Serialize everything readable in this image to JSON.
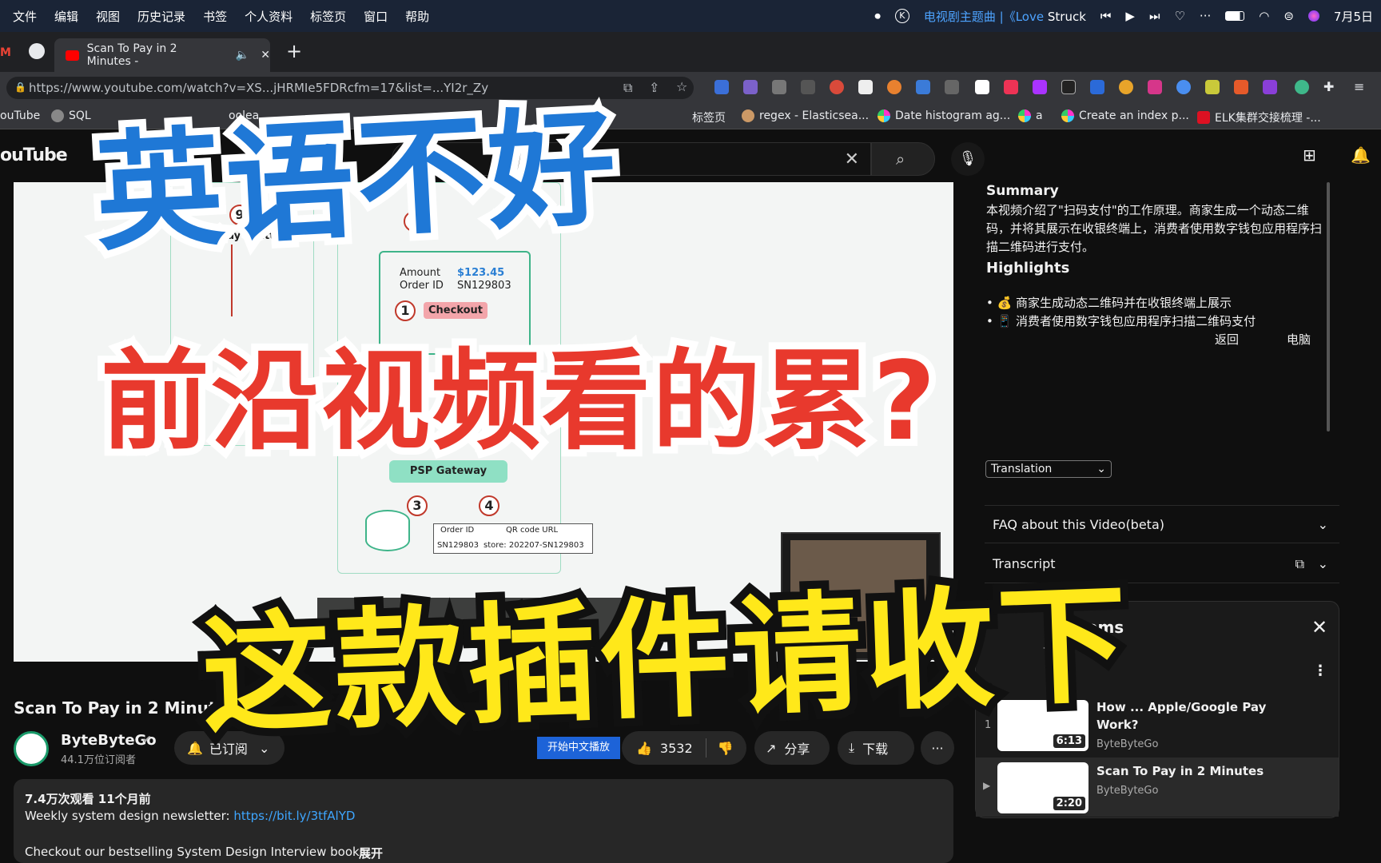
{
  "menubar": {
    "items": [
      "文件",
      "编辑",
      "视图",
      "历史记录",
      "书签",
      "个人资料",
      "标签页",
      "窗口",
      "帮助"
    ],
    "now_playing": "电视剧主题曲 |《Love",
    "now_playing_artist": "Struck",
    "date": "7月5日"
  },
  "tabs": {
    "active_title": "Scan To Pay in 2 Minutes -",
    "new_tab": "+"
  },
  "address": {
    "url": "https://www.youtube.com/watch?v=XS...jHRMIe5FDRcfm=17&list=...YI2r_Zy"
  },
  "bookmarks": [
    "ouTube",
    "SQL",
    "oolea",
    "标签页",
    "regex - Elasticsea...",
    "Date histogram ag...",
    "a",
    "Create an index p...",
    "ELK集群交接梳理 -..."
  ],
  "youtube": {
    "logo": "ouTube"
  },
  "video": {
    "amount_label": "Amount",
    "amount_value": "$123.45",
    "order_label": "Order ID",
    "order_value": "SN129803",
    "checkout": "Checkout",
    "click_pay": "Click \"Pay\" button",
    "gateway": "PSP Gateway",
    "tbl_order_id": "Order ID",
    "tbl_qr_url": "QR code URL",
    "tbl_order_val": "SN129803",
    "tbl_qr_val": "store: 202207-SN129803",
    "n1": "1",
    "n3": "3",
    "n4": "4",
    "n6": "6",
    "n9": "9"
  },
  "side": {
    "summary_heading": "Summary",
    "summary_text": "本视频介绍了\"扫码支付\"的工作原理。商家生成一个动态二维码，并将其展示在收银终端上，消费者使用数字钱包应用程序扫描二维码进行支付。",
    "highlights_heading": "Highlights",
    "h1": "• 💰 商家生成动态二维码并在收银终端上展示",
    "h2": "• 📱 消费者使用数字钱包应用程序扫描二维码支付",
    "h3": "返回",
    "h4": "电脑",
    "translation": "Translation",
    "faq": "FAQ about this Video(beta)",
    "transcript": "Transcript"
  },
  "playlist": {
    "title": "Systems",
    "count": "- 2 / 2",
    "items": [
      {
        "index": "1",
        "title": "How ... Apple/Google Pay Work?",
        "channel": "ByteByteGo",
        "duration": "6:13"
      },
      {
        "index": "▶",
        "title": "Scan To Pay in 2 Minutes",
        "channel": "ByteByteGo",
        "duration": "2:20"
      }
    ]
  },
  "meta": {
    "title": "Scan To Pay in 2 Minutes",
    "channel": "ByteByteGo",
    "subs": "44.1万位订阅者",
    "subscribed": "已订阅",
    "cn_play": "开始中文播放",
    "likes": "3532",
    "share": "分享",
    "download": "下载",
    "more": "···"
  },
  "description": {
    "stats": "7.4万次观看  11个月前",
    "line1": "Weekly system design newsletter: ",
    "link": "https://bit.ly/3tfAlYD",
    "line2": "Checkout our bestselling System Design Interview books:",
    "expand": "展开"
  },
  "overlay": {
    "line1": "英语不好",
    "line2": "前沿视频看的累?",
    "line3": "这款插件请收下"
  },
  "colors": {
    "overlay_blue": "#1f78d6",
    "overlay_red": "#e8392d",
    "overlay_yellow": "#ffe81a",
    "accent": "#3ea6ff",
    "cn_btn": "#1d63d8"
  }
}
